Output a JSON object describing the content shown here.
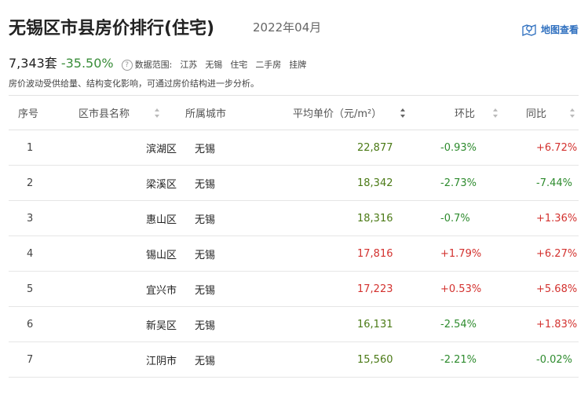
{
  "header": {
    "title": "无锡区市县房价排行(住宅)",
    "date": "2022年04月",
    "map_link_label": "地图查看"
  },
  "summary": {
    "count": "7,343套",
    "change": "-35.50%",
    "scope_label": "数据范围:",
    "scope_items": [
      "江苏",
      "无锡",
      "住宅",
      "二手房",
      "挂牌"
    ]
  },
  "note": "房价波动受供给量、结构变化影响，可通过房价结构进一步分析。",
  "table": {
    "columns": [
      "序号",
      "区市县名称",
      "所属城市",
      "平均单价（元/m²）",
      "环比",
      "同比"
    ],
    "rows": [
      {
        "idx": "1",
        "name": "滨湖区",
        "city": "无锡",
        "price": "22,877",
        "mom": "-0.93%",
        "yoy": "+6.72%"
      },
      {
        "idx": "2",
        "name": "梁溪区",
        "city": "无锡",
        "price": "18,342",
        "mom": "-2.73%",
        "yoy": "-7.44%"
      },
      {
        "idx": "3",
        "name": "惠山区",
        "city": "无锡",
        "price": "18,316",
        "mom": "-0.7%",
        "yoy": "+1.36%"
      },
      {
        "idx": "4",
        "name": "锡山区",
        "city": "无锡",
        "price": "17,816",
        "mom": "+1.79%",
        "yoy": "+6.27%"
      },
      {
        "idx": "5",
        "name": "宜兴市",
        "city": "无锡",
        "price": "17,223",
        "mom": "+0.53%",
        "yoy": "+5.68%"
      },
      {
        "idx": "6",
        "name": "新吴区",
        "city": "无锡",
        "price": "16,131",
        "mom": "-2.54%",
        "yoy": "+1.83%"
      },
      {
        "idx": "7",
        "name": "江阴市",
        "city": "无锡",
        "price": "15,560",
        "mom": "-2.21%",
        "yoy": "-0.02%"
      }
    ]
  },
  "colors": {
    "up": "#d3322f",
    "down": "#2e8b2e",
    "link": "#2e6fbf"
  },
  "icons": {
    "map_link": "map-pin-icon",
    "help": "question-circle-icon",
    "sort": "sort-arrows-icon"
  }
}
